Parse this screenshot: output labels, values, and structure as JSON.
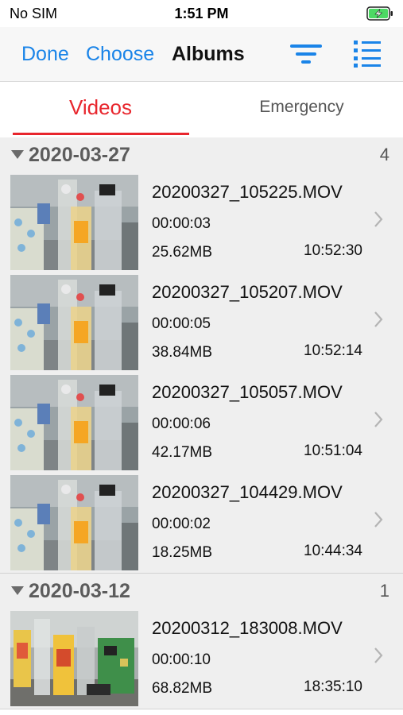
{
  "status_bar": {
    "carrier": "No SIM",
    "time": "1:51 PM",
    "battery_icon": "battery-charging-icon",
    "battery_color": "#4cd964"
  },
  "nav": {
    "done_label": "Done",
    "choose_label": "Choose",
    "title": "Albums",
    "filter_icon": "filter-icon",
    "list_icon": "list-icon",
    "accent_color": "#1a84e8"
  },
  "tabs": [
    {
      "label": "Videos",
      "selected": true,
      "color": "#e8262d"
    },
    {
      "label": "Emergency",
      "selected": false
    }
  ],
  "sections": [
    {
      "date": "2020-03-27",
      "count": "4",
      "items": [
        {
          "name": "20200327_105225.MOV",
          "duration": "00:00:03",
          "size": "25.62MB",
          "time": "10:52:30"
        },
        {
          "name": "20200327_105207.MOV",
          "duration": "00:00:05",
          "size": "38.84MB",
          "time": "10:52:14"
        },
        {
          "name": "20200327_105057.MOV",
          "duration": "00:00:06",
          "size": "42.17MB",
          "time": "10:51:04"
        },
        {
          "name": "20200327_104429.MOV",
          "duration": "00:00:02",
          "size": "18.25MB",
          "time": "10:44:34"
        }
      ]
    },
    {
      "date": "2020-03-12",
      "count": "1",
      "items": [
        {
          "name": "20200312_183008.MOV",
          "duration": "00:00:10",
          "size": "68.82MB",
          "time": "18:35:10"
        }
      ]
    }
  ]
}
